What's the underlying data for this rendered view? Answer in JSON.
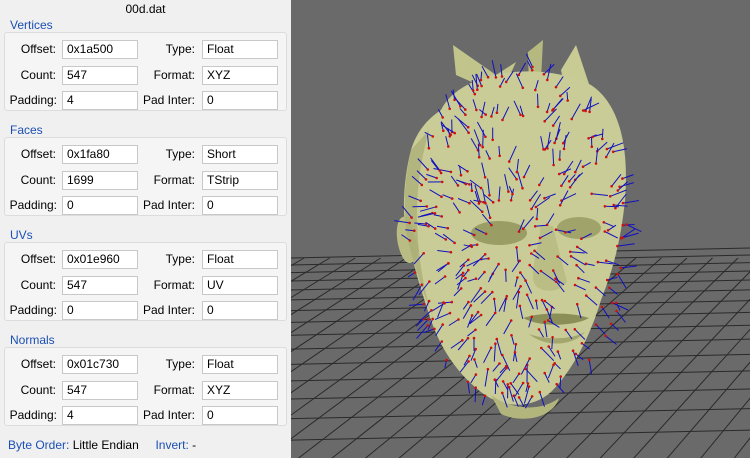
{
  "file_title": "00d.dat",
  "groups": [
    {
      "title": "Vertices",
      "offset": "0x1a500",
      "count": "547",
      "padding": "4",
      "type": "Float",
      "format": "XYZ",
      "pad_inter": "0"
    },
    {
      "title": "Faces",
      "offset": "0x1fa80",
      "count": "1699",
      "padding": "0",
      "type": "Short",
      "format": "TStrip",
      "pad_inter": "0"
    },
    {
      "title": "UVs",
      "offset": "0x01e960",
      "count": "547",
      "padding": "0",
      "type": "Float",
      "format": "UV",
      "pad_inter": "0"
    },
    {
      "title": "Normals",
      "offset": "0x01c730",
      "count": "547",
      "padding": "4",
      "type": "Float",
      "format": "XYZ",
      "pad_inter": "0"
    }
  ],
  "labels": {
    "offset": "Offset:",
    "count": "Count:",
    "padding": "Padding:",
    "type": "Type:",
    "format": "Format:",
    "pad_inter": "Pad Inter:"
  },
  "footer": {
    "byte_order_label": "Byte Order:",
    "byte_order_value": "Little Endian",
    "invert_label": "Invert:",
    "invert_value": "-"
  },
  "colors": {
    "panel_bg": "#f0f0f0",
    "group_title": "#1b4fb3",
    "viewport_bg": "#6a6a6a",
    "grid": "#2a2a2a",
    "mesh": "#c9cc96",
    "normal_line": "#1010c0",
    "vertex_dot": "#cc1111"
  }
}
